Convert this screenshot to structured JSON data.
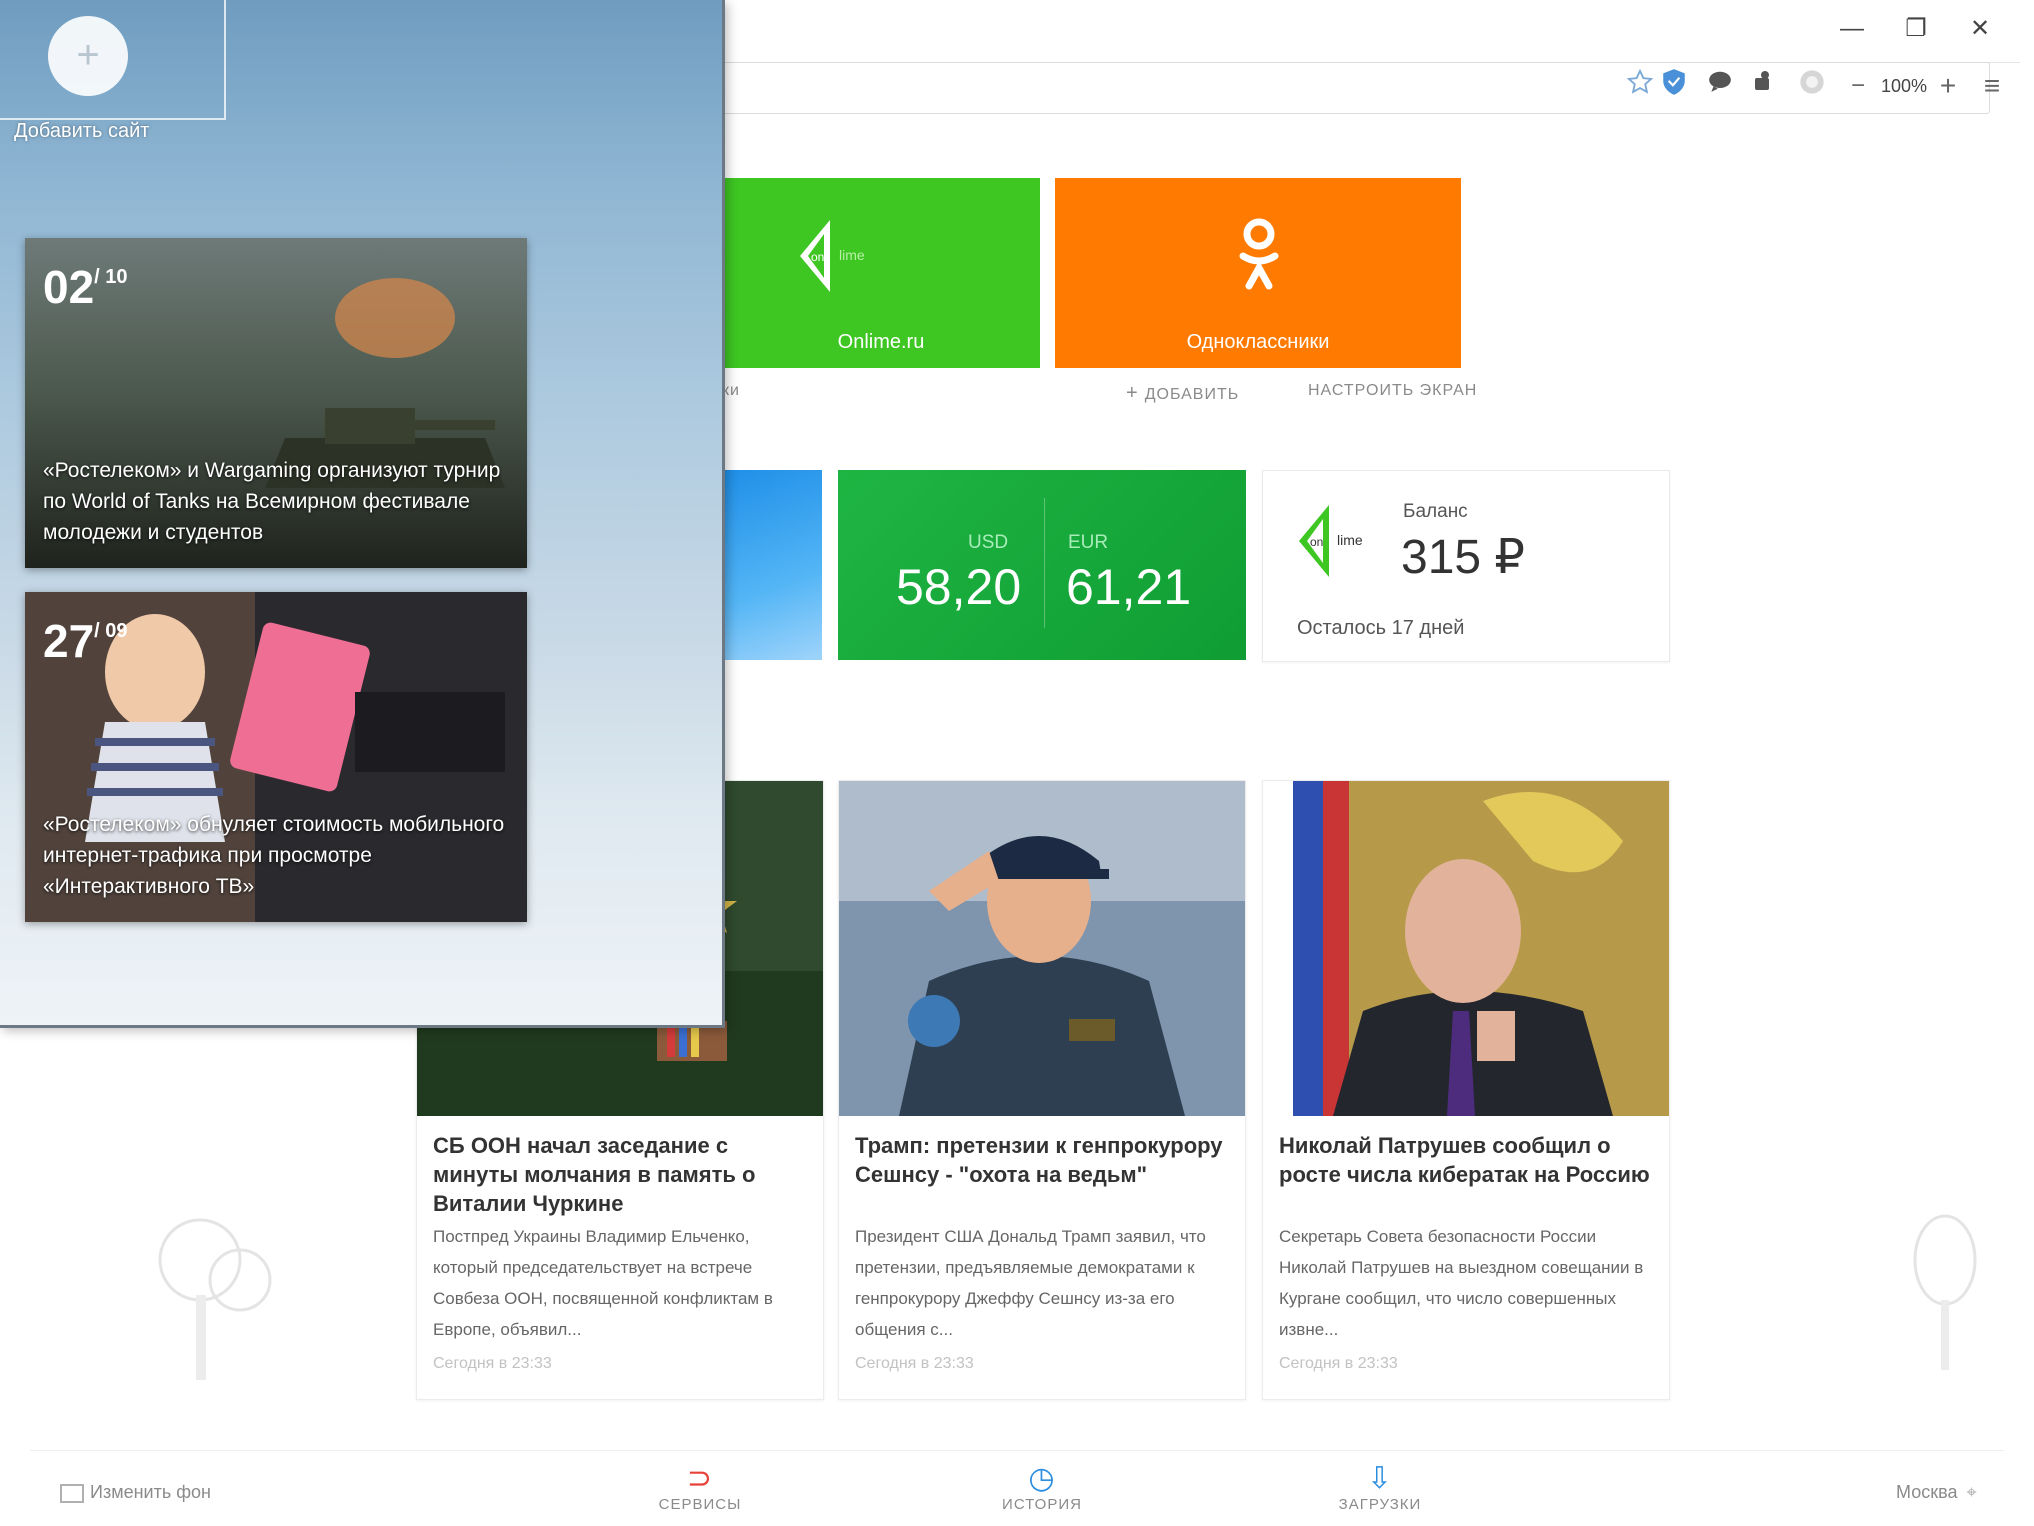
{
  "side_panel": {
    "add_site_label": "Добавить сайт",
    "add_site_symbol": "+",
    "promos": [
      {
        "day": "02",
        "month": "10",
        "text": "«Ростелеком» и Wargaming организуют турнир по World of Tanks на Всемирном фестивале молодежи и студентов"
      },
      {
        "day": "27",
        "month": "09",
        "text": "«Ростелеком» обнуляет стоимость мобильного интернет-трафика при просмотре «Интерактивного ТВ»"
      }
    ]
  },
  "toolbar": {
    "zoom": "100%",
    "minus": "−",
    "plus": "+",
    "menu": "≡"
  },
  "window_controls": {
    "minimize": "—",
    "restore": "❐",
    "close": "✕"
  },
  "tiles": [
    {
      "label": "Onlime.ru",
      "color": "#3ec623"
    },
    {
      "label": "Одноклассники",
      "color": "#ff7a00"
    }
  ],
  "tiles_actions": {
    "partial_left": "ки",
    "add": "ДОБАВИТЬ",
    "add_symbol": "+",
    "customize": "НАСТРОИТЬ ЭКРАН"
  },
  "currency": {
    "usd_label": "USD",
    "usd_value": "58,20",
    "eur_label": "EUR",
    "eur_value": "61,21"
  },
  "balance": {
    "label": "Баланс",
    "amount": "315 ₽",
    "remaining": "Осталось 17 дней",
    "logo_on": "on",
    "logo_lime": "lime"
  },
  "news": [
    {
      "title": "СБ ООН начал заседание с минуты молчания в память о Виталии Чуркине",
      "desc": "Постпред Украины Владимир Ельченко, который председательствует на встрече Совбеза ООН, посвященной конфликтам в Европе, объявил...",
      "time": "Сегодня в 23:33"
    },
    {
      "title": "Трамп: претензии к генпрокурору Сешнсу - \"охота на ведьм\"",
      "desc": "Президент США Дональд Трамп заявил, что претензии, предъявляемые демократами к генпрокурору Джеффу Сешнсу из-за его общения с...",
      "time": "Сегодня в 23:33"
    },
    {
      "title": "Николай Патрушев сообщил о росте числа кибератак на Россию",
      "desc": "Секретарь Совета безопасности России Николай Патрушев на выездном совещании в Кургане сообщил, что число совершенных извне...",
      "time": "Сегодня в 23:33"
    }
  ],
  "bottom_bar": {
    "change_bg": "Изменить фон",
    "services": "СЕРВИСЫ",
    "history": "ИСТОРИЯ",
    "downloads": "ЗАГРУЗКИ",
    "city": "Москва"
  },
  "colors": {
    "onlime_green": "#3ec623",
    "ok_orange": "#ff7a00",
    "currency_green": "#1fb543",
    "services_red": "#e8413a",
    "history_blue": "#2a8de0"
  }
}
